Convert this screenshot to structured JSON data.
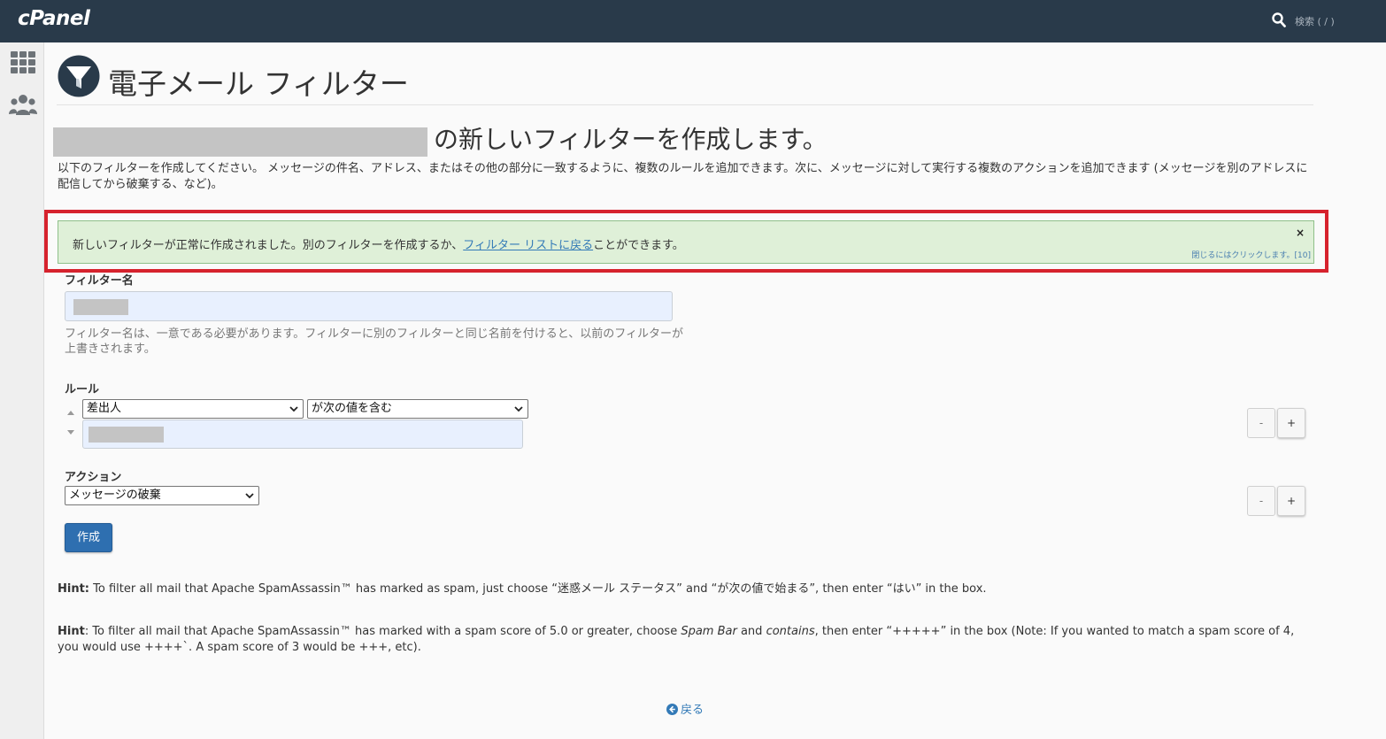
{
  "topbar": {
    "logo": "cPanel",
    "search_label": "検索 ( / )",
    "search_icon": "search-icon"
  },
  "sidebar": {
    "items": [
      {
        "icon": "grid-icon"
      },
      {
        "icon": "users-icon"
      }
    ]
  },
  "page": {
    "title": "電子メール フィルター",
    "title_icon": "funnel-icon",
    "subtitle": "の新しいフィルターを作成します。",
    "intro": "以下のフィルターを作成してください。 メッセージの件名、アドレス、またはその他の部分に一致するように、複数のルールを追加できます。次に、メッセージに対して実行する複数のアクションを追加できます (メッセージを別のアドレスに配信してから破棄する、など)。"
  },
  "alert": {
    "message_before": "新しいフィルターが正常に作成されました。別のフィルターを作成するか、",
    "link_text": "フィルター リストに戻る",
    "message_after": "ことができます。",
    "close_label": "×",
    "close_hint": "閉じるにはクリックします。[10]",
    "highlight_color": "#d6222d",
    "background_color": "#dff0d8"
  },
  "form": {
    "filter_name_label": "フィルター名",
    "filter_name_help": "フィルター名は、一意である必要があります。フィルターに別のフィルターと同じ名前を付けると、以前のフィルターが上書きされます。",
    "rules_label": "ルール",
    "rule_field_selected": "差出人",
    "rule_operator_selected": "が次の値を含む",
    "actions_label": "アクション",
    "action_selected": "メッセージの破棄",
    "minus_label": "-",
    "plus_label": "+",
    "create_button": "作成"
  },
  "hints": {
    "hint1_label": "Hint:",
    "hint1_text": "To filter all mail that Apache SpamAssassin™ has marked as spam, just choose “迷惑メール ステータス” and “が次の値で始まる”, then enter “はい” in the box.",
    "hint2_label": "Hint",
    "hint2_sep": ": To filter all mail that Apache SpamAssassin™ has marked with a spam score of 5.0 or greater, choose ",
    "hint2_spam_bar": "Spam Bar",
    "hint2_and": " and ",
    "hint2_contains": "contains",
    "hint2_rest": ", then enter “+++++” in the box (Note: If you wanted to match a spam score of 4, you would use ++++`. A spam score of 3 would be +++, etc)."
  },
  "footer": {
    "back_label": "戻る",
    "back_icon": "arrow-circle-left-icon"
  },
  "colors": {
    "topbar": "#293a4a",
    "link": "#337ab7",
    "primary_button": "#2e6fb0"
  }
}
